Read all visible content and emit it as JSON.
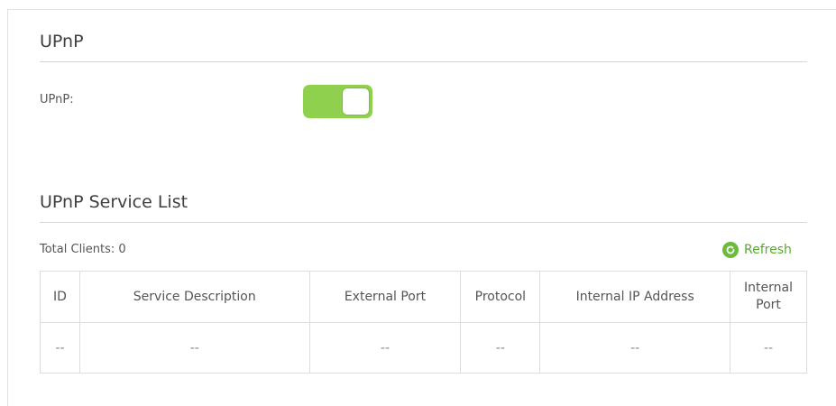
{
  "upnp_section": {
    "title": "UPnP",
    "field_label": "UPnP:",
    "enabled": true
  },
  "service_list": {
    "title": "UPnP Service List",
    "total_clients_label": "Total Clients: 0",
    "refresh_label": "Refresh",
    "columns": [
      "ID",
      "Service Description",
      "External Port",
      "Protocol",
      "Internal IP Address",
      "Internal Port"
    ],
    "rows": [
      [
        "--",
        "--",
        "--",
        "--",
        "--",
        "--"
      ]
    ]
  },
  "colors": {
    "toggle_on": "#8fd14f",
    "accent_green": "#5aa832"
  },
  "icons": {
    "refresh": "refresh-icon"
  }
}
